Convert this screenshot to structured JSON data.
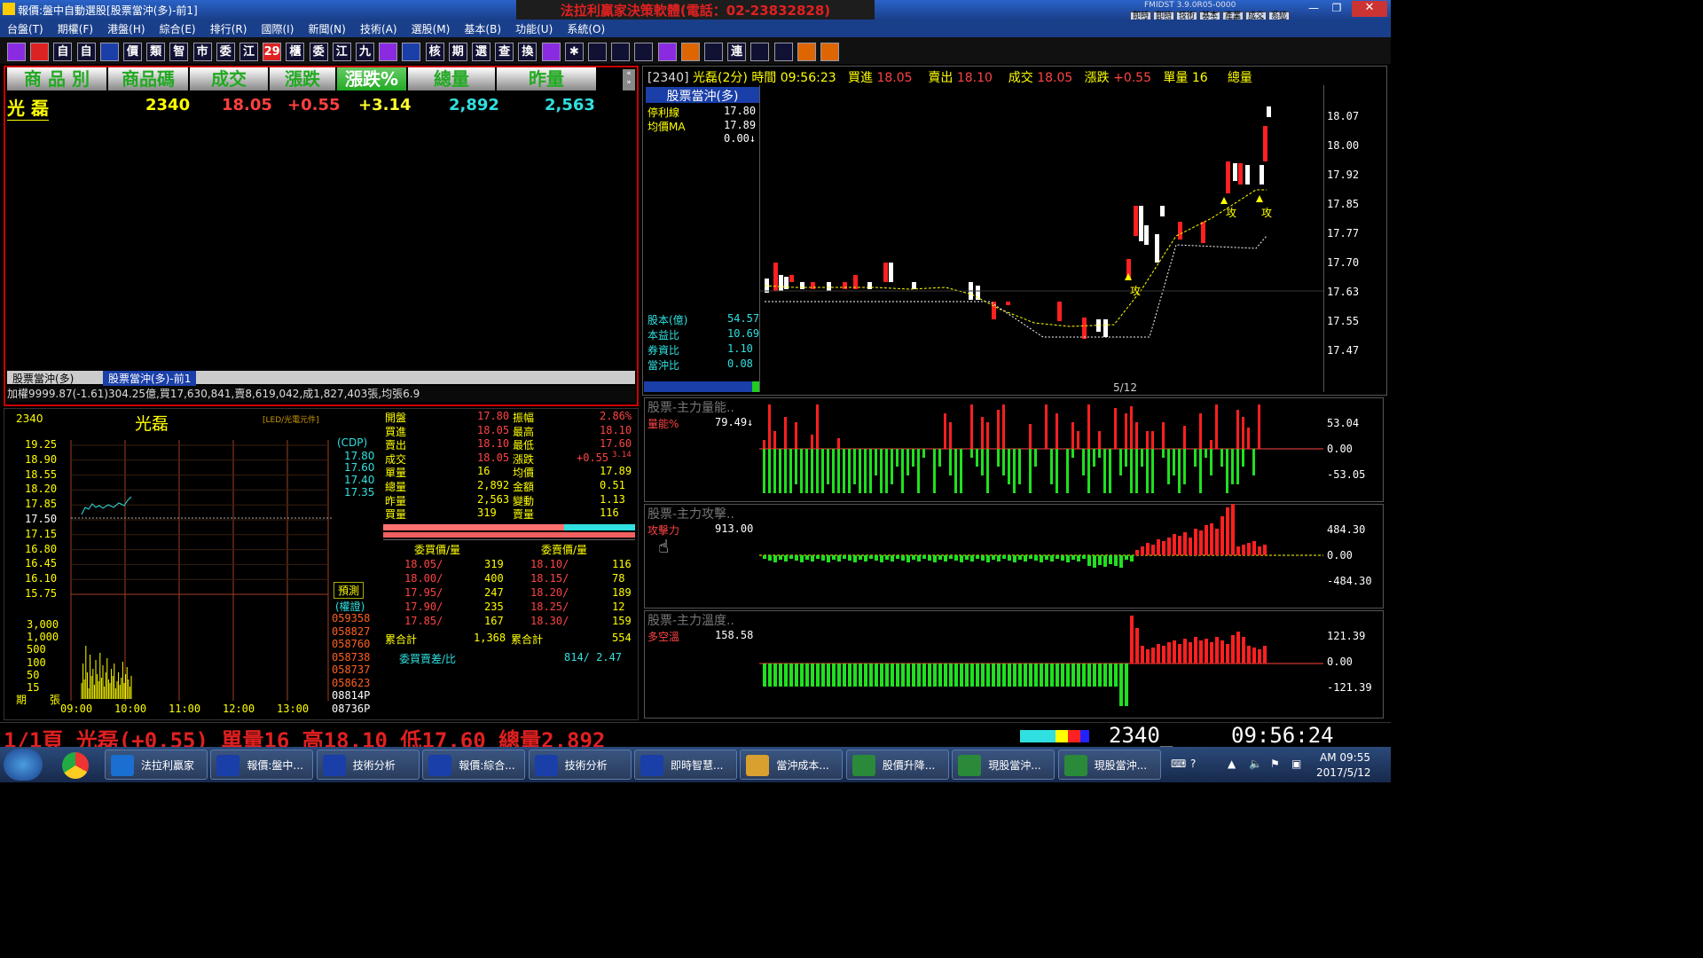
{
  "window": {
    "title": "報價:盤中自動選股[股票當沖(多)-前1]",
    "banner": "法拉利贏家決策軟體(電話：02-23832828)",
    "version": "FMIDST 3.9.0R05-0000",
    "top_buttons": [
      "即時行情",
      "即時新聞",
      "技術分析",
      "基本分析",
      "產業總覽",
      "成交明細",
      "系統設定"
    ]
  },
  "menu": [
    "台盤(T)",
    "期權(F)",
    "港盤(H)",
    "綜合(E)",
    "排行(R)",
    "國際(I)",
    "新聞(N)",
    "技術(A)",
    "選股(M)",
    "基本(B)",
    "功能(U)",
    "系統(O)"
  ],
  "toolbar": [
    "",
    "",
    "自",
    "自",
    "",
    "價",
    "類",
    "智",
    "市",
    "委",
    "江",
    "29",
    "櫃",
    "委",
    "江",
    "九",
    "",
    "",
    "核",
    "期",
    "選",
    "查",
    "換",
    "",
    "✱",
    "",
    "",
    "",
    "",
    "",
    "",
    "連",
    "",
    "",
    "",
    ""
  ],
  "quote_table": {
    "headers": [
      "商 品 別",
      "商品碼",
      "成交",
      "漲跌",
      "漲跌%",
      "總量",
      "昨量"
    ],
    "row": {
      "name": "光 磊",
      "code": "2340",
      "price": "18.05",
      "change": "+0.55",
      "change_pct": "+3.14",
      "volume": "2,892",
      "prev_volume": "2,563"
    },
    "tabs": [
      "股票當沖(多)",
      "股票當沖(多)-前1"
    ],
    "index_line": "加權9999.87(-1.61)304.25億,買17,630,841,賣8,619,042,成1,827,403張,均張6.9"
  },
  "mini_chart": {
    "code": "2340",
    "name": "光磊",
    "subtitle": "[LED/光電元件]",
    "price_ticks": [
      "19.25",
      "18.90",
      "18.55",
      "18.20",
      "17.85",
      "17.50",
      "17.15",
      "16.80",
      "16.45",
      "16.10",
      "15.75"
    ],
    "vol_ticks": [
      "3,000",
      "1,000",
      "500",
      "100",
      "50",
      "15"
    ],
    "time_ticks": [
      "09:00",
      "10:00",
      "11:00",
      "12:00",
      "13:00"
    ],
    "vol_unit": "張",
    "period_label": "期",
    "cdp": "(CDP)",
    "cdp_values": [
      "17.80",
      "17.60",
      "17.40",
      "17.35"
    ],
    "predict": "預測",
    "weighted": "(權證)",
    "codes": [
      "059358",
      "058827",
      "058760",
      "058738",
      "058737",
      "058623",
      "08814P",
      "08736P"
    ]
  },
  "detail": {
    "rows": [
      [
        "開盤",
        "17.80",
        "振幅",
        "2.86%"
      ],
      [
        "買進",
        "18.05",
        "最高",
        "18.10"
      ],
      [
        "賣出",
        "18.10",
        "最低",
        "17.60"
      ],
      [
        "成交",
        "18.05",
        "漲跌",
        "+0.55",
        "3.14"
      ],
      [
        "單量",
        "16",
        "均價",
        "17.89"
      ],
      [
        "總量",
        "2,892",
        "金額",
        "0.51"
      ],
      [
        "昨量",
        "2,563",
        "變動",
        "1.13"
      ],
      [
        "買量",
        "319",
        "賣量",
        "116"
      ]
    ],
    "bid_header": "委買價/量",
    "ask_header": "委賣價/量",
    "bids": [
      [
        "18.05/",
        "319"
      ],
      [
        "18.00/",
        "400"
      ],
      [
        "17.95/",
        "247"
      ],
      [
        "17.90/",
        "235"
      ],
      [
        "17.85/",
        "167"
      ]
    ],
    "asks": [
      [
        "18.10/",
        "116"
      ],
      [
        "18.15/",
        "78"
      ],
      [
        "18.20/",
        "189"
      ],
      [
        "18.25/",
        "12"
      ],
      [
        "18.30/",
        "159"
      ]
    ],
    "bid_total_label": "累合計",
    "bid_total": "1,368",
    "ask_total_label": "累合計",
    "ask_total": "554",
    "diff_label": "委買賣差/比",
    "diff_value": "814/ 2.47"
  },
  "main_chart": {
    "header": {
      "code": "[2340]",
      "name": "光磊(2分)",
      "time_label": "時間",
      "time": "09:56:23",
      "bid_label": "買進",
      "bid": "18.05",
      "ask_label": "賣出",
      "ask": "18.10",
      "deal_label": "成交",
      "deal": "18.05",
      "chg_label": "漲跌",
      "chg": "+0.55",
      "qty_label": "單量",
      "qty": "16",
      "total_label": "總量"
    },
    "strategy": "股票當沖(多)",
    "indicators": [
      [
        "停利線",
        "17.80"
      ],
      [
        "均價MA",
        "17.89"
      ],
      [
        "",
        "0.00↓"
      ]
    ],
    "fundamentals": [
      [
        "股本(億)",
        "54.57"
      ],
      [
        "本益比",
        "10.69"
      ],
      [
        "券資比",
        "1.10"
      ],
      [
        "當沖比",
        "0.08"
      ]
    ],
    "yticks": [
      "18.07",
      "18.00",
      "17.92",
      "17.85",
      "17.77",
      "17.70",
      "17.63",
      "17.55",
      "17.47"
    ],
    "date": "5/12",
    "signal": "攻"
  },
  "sub1": {
    "title": "股票-主力量能..",
    "label": "量能%",
    "value": "79.49↓",
    "yticks": [
      "53.04",
      "0.00",
      "-53.05"
    ]
  },
  "sub2": {
    "title": "股票-主力攻擊..",
    "label": "攻擊力",
    "value": "913.00",
    "yticks": [
      "484.30",
      "0.00",
      "-484.30"
    ]
  },
  "sub3": {
    "title": "股票-主力溫度..",
    "label": "多空溫",
    "value": "158.58",
    "yticks": [
      "121.39",
      "0.00",
      "-121.39"
    ]
  },
  "ticker": {
    "text": "1/1頁 光磊(+0.55) 單量16 高18.10 低17.60 總量2,892",
    "code": "2340_",
    "time": "09:56:24"
  },
  "taskbar": {
    "items": [
      "法拉利贏家",
      "報價:盤中...",
      "技術分析",
      "報價:綜合...",
      "技術分析",
      "即時智慧...",
      "當沖成本...",
      "股價升降...",
      "現股當沖...",
      "現股當沖..."
    ],
    "clock_time": "AM 09:55",
    "clock_date": "2017/5/12"
  },
  "colors": {
    "red": "#ff2020",
    "green": "#20e020",
    "yellow": "#ffff30",
    "cyan": "#30e0e0",
    "orange": "#ff9020"
  }
}
